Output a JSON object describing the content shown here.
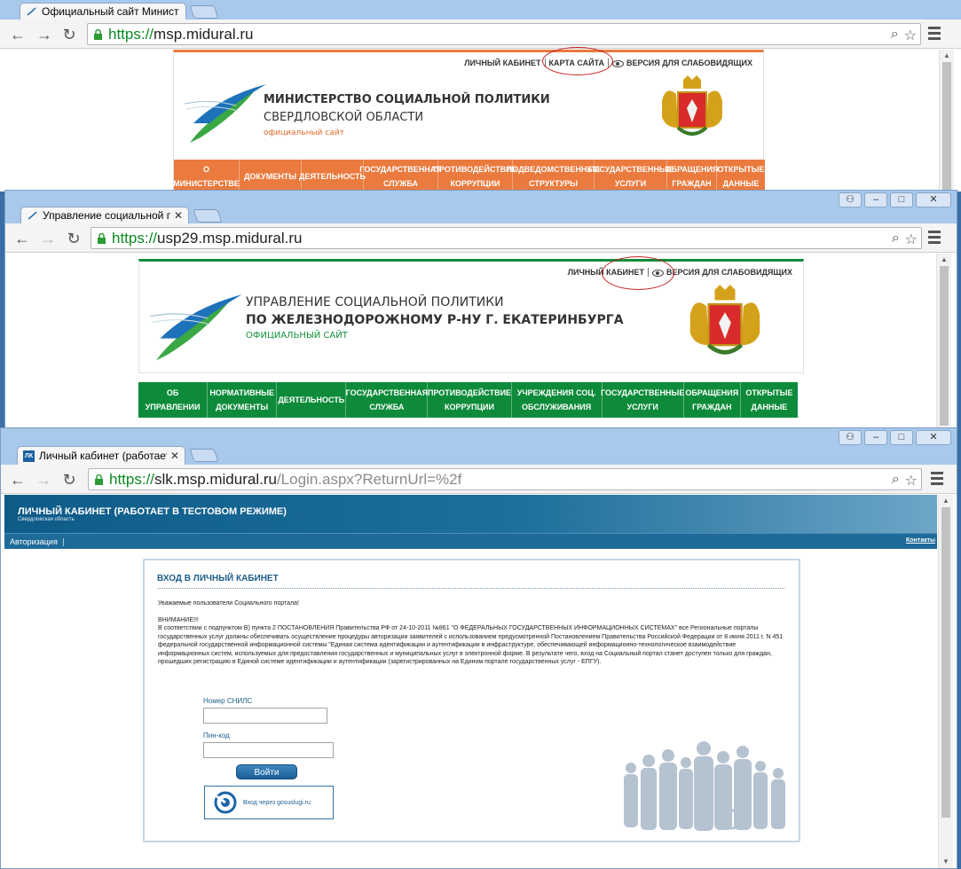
{
  "window1": {
    "tab_title": "Официальный сайт Минист",
    "url_scheme": "https://",
    "url_host": "msp.midural.ru",
    "url_path": "",
    "toplinks": [
      "ЛИЧНЫЙ КАБИНЕТ",
      "КАРТА САЙТА",
      "ВЕРСИЯ ДЛЯ СЛАБОВИДЯЩИХ"
    ],
    "ministry_line1": "МИНИСТЕРСТВО СОЦИАЛЬНОЙ ПОЛИТИКИ",
    "ministry_line2": "СВЕРДЛОВСКОЙ ОБЛАСТИ",
    "ministry_line3": "официальный сайт",
    "nav": [
      {
        "l1": "О МИНИСТЕРСТВЕ",
        "l2": ""
      },
      {
        "l1": "ДОКУМЕНТЫ",
        "l2": ""
      },
      {
        "l1": "ДЕЯТЕЛЬНОСТЬ",
        "l2": ""
      },
      {
        "l1": "ГОСУДАРСТВЕННАЯ",
        "l2": "СЛУЖБА"
      },
      {
        "l1": "ПРОТИВОДЕЙСТВИЕ",
        "l2": "КОРРУПЦИИ"
      },
      {
        "l1": "ПОДВЕДОМСТВЕННЫЕ",
        "l2": "СТРУКТУРЫ"
      },
      {
        "l1": "ГОСУДАРСТВЕННЫЕ",
        "l2": "УСЛУГИ"
      },
      {
        "l1": "ОБРАЩЕНИЯ",
        "l2": "ГРАЖДАН"
      },
      {
        "l1": "ОТКРЫТЫЕ",
        "l2": "ДАННЫЕ"
      }
    ],
    "colors": {
      "accent": "#ea7a3e"
    }
  },
  "window2": {
    "tab_title": "Управление социальной по",
    "url_scheme": "https://",
    "url_host": "usp29.msp.midural.ru",
    "url_path": "",
    "toplinks": [
      "ЛИЧНЫЙ КАБИНЕТ",
      "ВЕРСИЯ ДЛЯ СЛАБОВИДЯЩИХ"
    ],
    "org_line1": "УПРАВЛЕНИЕ СОЦИАЛЬНОЙ ПОЛИТИКИ",
    "org_line2": "ПО ЖЕЛЕЗНОДОРОЖНОМУ Р-НУ Г. ЕКАТЕРИНБУРГА",
    "org_line3": "ОФИЦИАЛЬНЫЙ САЙТ",
    "nav": [
      {
        "l1": "ОБ УПРАВЛЕНИИ",
        "l2": ""
      },
      {
        "l1": "НОРМАТИВНЫЕ",
        "l2": "ДОКУМЕНТЫ"
      },
      {
        "l1": "ДЕЯТЕЛЬНОСТЬ",
        "l2": ""
      },
      {
        "l1": "ГОСУДАРСТВЕННАЯ",
        "l2": "СЛУЖБА"
      },
      {
        "l1": "ПРОТИВОДЕЙСТВИЕ",
        "l2": "КОРРУПЦИИ"
      },
      {
        "l1": "УЧРЕЖДЕНИЯ СОЦ.",
        "l2": "ОБСЛУЖИВАНИЯ"
      },
      {
        "l1": "ГОСУДАРСТВЕННЫЕ",
        "l2": "УСЛУГИ"
      },
      {
        "l1": "ОБРАЩЕНИЯ",
        "l2": "ГРАЖДАН"
      },
      {
        "l1": "ОТКРЫТЫЕ",
        "l2": "ДАННЫЕ"
      }
    ],
    "colors": {
      "accent": "#0d8b3a"
    }
  },
  "window3": {
    "tab_title": "Личный кабинет (работает",
    "tab_favicon": "ЛК",
    "url_scheme": "https://",
    "url_host": "slk.msp.midural.ru",
    "url_path": "/Login.aspx?ReturnUrl=%2f",
    "header_title": "ЛИЧНЫЙ КАБИНЕТ (РАБОТАЕТ В ТЕСТОВОМ РЕЖИМЕ)",
    "header_sub": "Свердловская область",
    "subnav_auth": "Авторизация",
    "subnav_contacts": "Контакты",
    "box_title": "ВХОД В ЛИЧНЫЙ КАБИНЕТ",
    "greeting": "Уважаемые пользователи Социального портала!",
    "attention": "ВНИМАНИЕ!!!",
    "notice": "В соответствии с подпунктом В) пункта 2 ПОСТАНОВЛЕНИЯ Правительства РФ от 24-10-2011 №861 \"О ФЕДЕРАЛЬНЫХ ГОСУДАРСТВЕННЫХ ИНФОРМАЦИОННЫХ СИСТЕМАХ\" все Региональные порталы государственных услуг должны обеспечивать осуществление процедуры авторизации заявителей с использованием предусмотренной Постановлением Правительства Российской Федерации от 8 июня 2011 г. N 451 федеральной государственной информационной системы \"Единая система идентификации и аутентификации в инфраструктуре, обеспечивающей информационно-технологическое взаимодействие информационных систем, используемых для предоставления государственных и муниципальных услуг в электронной форме. В результате чего, вход на Социальный портал станет доступен только для граждан, прошедших регистрацию в Единой системе идентификации и аутентификации (зарегистрированных на Едином портале государственных услуг - ЕПГУ).",
    "snils_label": "Номер СНИЛС",
    "snils_value": "",
    "pin_label": "Пин-код",
    "pin_value": "",
    "login_button": "Войти",
    "gosuslugi_button": "Вход через gosuslugi.ru",
    "colors": {
      "accent": "#1d6f9c"
    }
  }
}
